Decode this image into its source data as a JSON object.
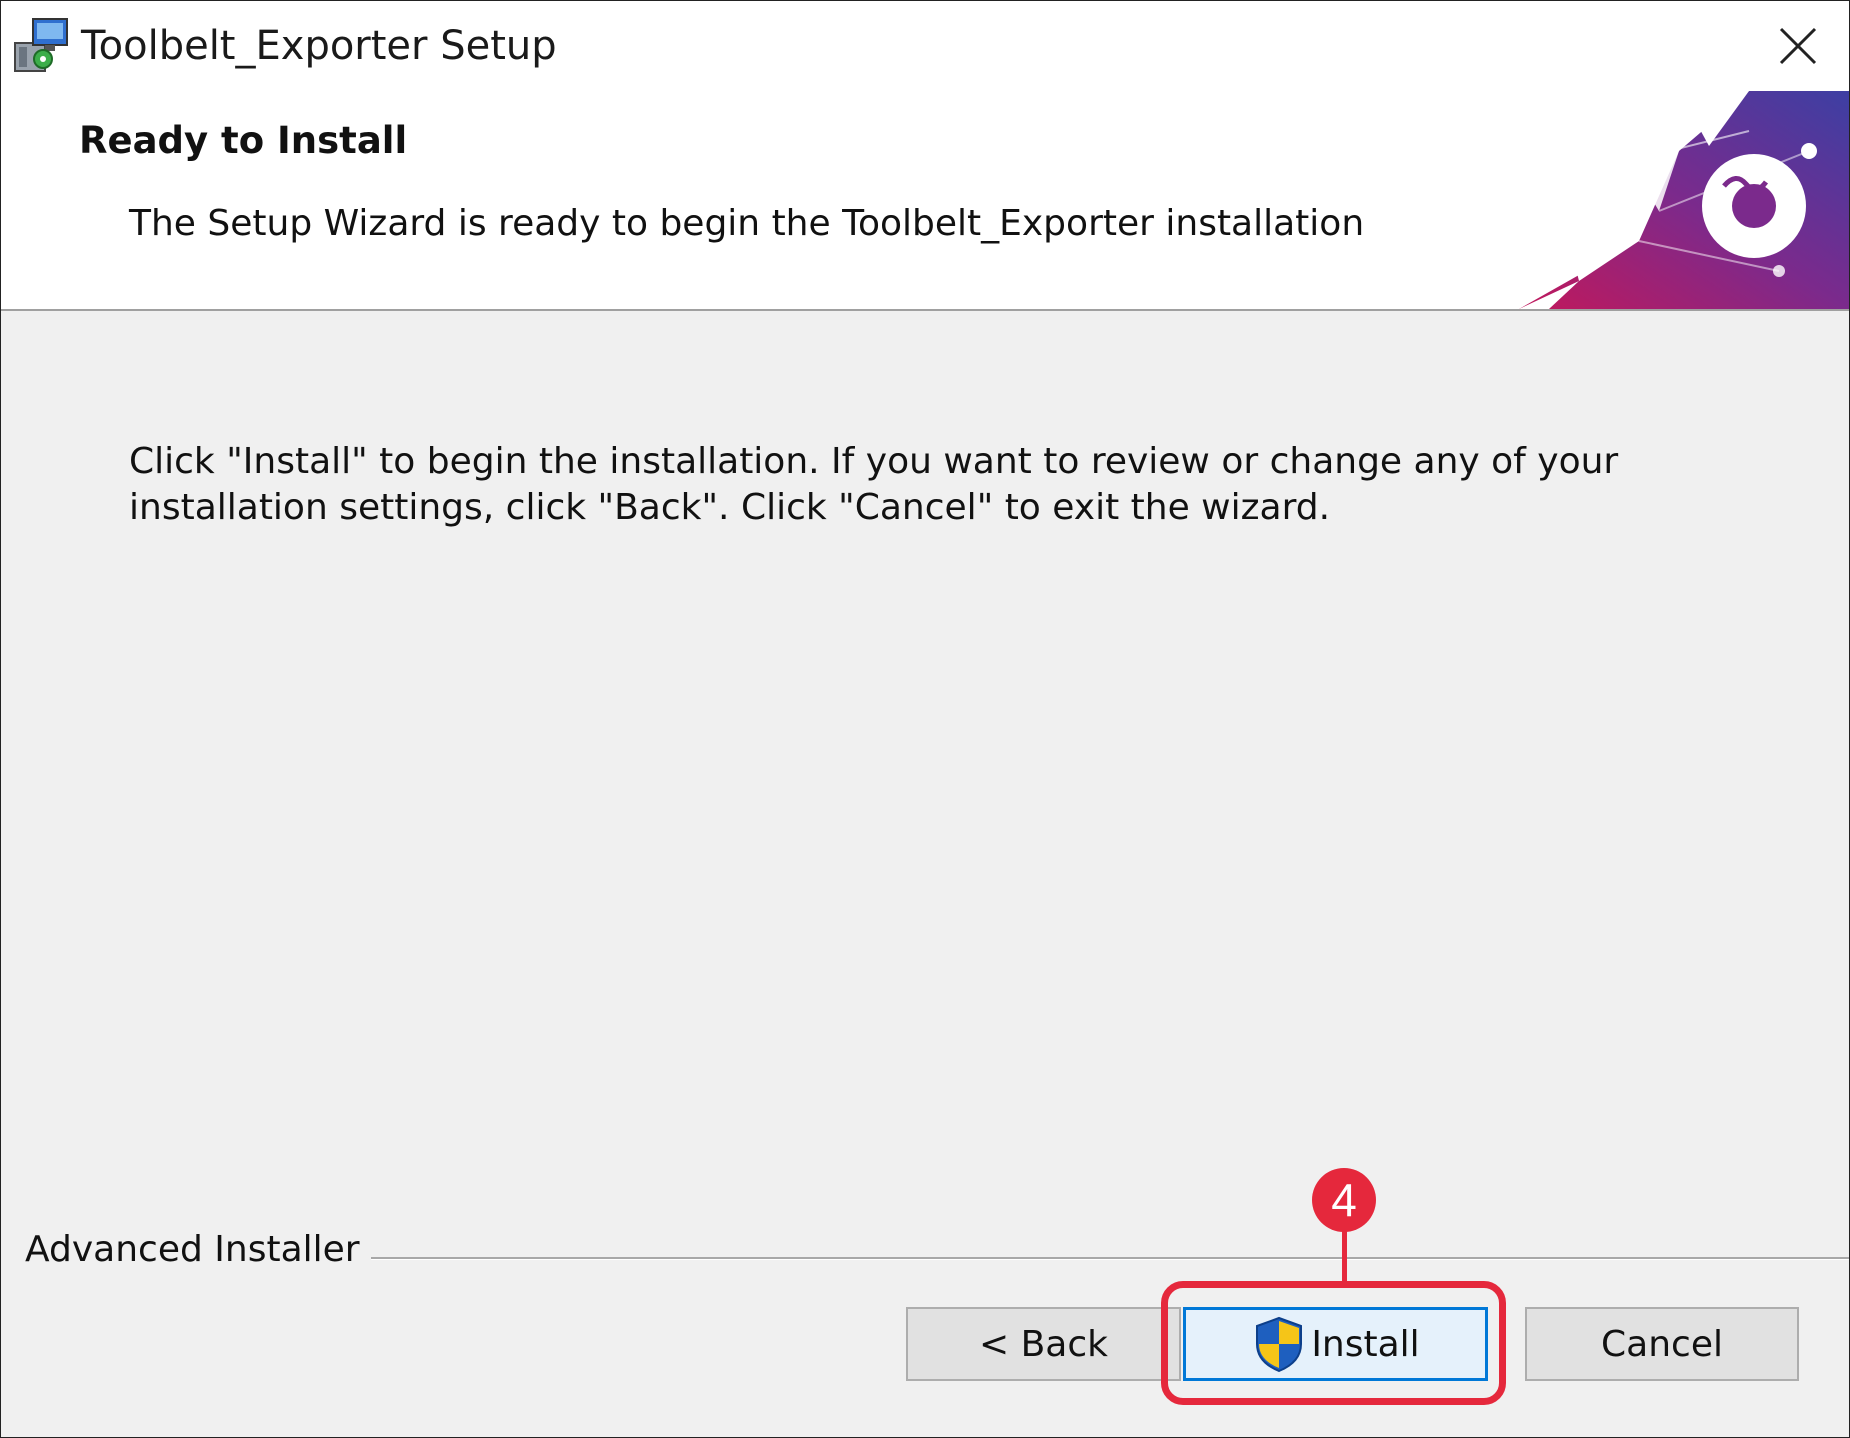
{
  "window": {
    "title": "Toolbelt_Exporter Setup",
    "close_icon": "close-icon"
  },
  "header": {
    "title": "Ready to Install",
    "subtitle": "The Setup Wizard is ready to begin the Toolbelt_Exporter installation"
  },
  "body": {
    "instructions_line1": "Click \"Install\" to begin the installation.  If you want to review or change any of your",
    "instructions_line2": "installation settings, click \"Back\".  Click \"Cancel\" to exit the wizard."
  },
  "footer": {
    "brand": "Advanced Installer",
    "back_label": "< Back",
    "install_label": "Install",
    "cancel_label": "Cancel"
  },
  "annotation": {
    "step_number": "4",
    "color": "#e5283c"
  },
  "colors": {
    "accent": "#0078d7",
    "dialog_background": "#f0f0f0",
    "banner_purple": "#5b2a86",
    "banner_magenta": "#c2185b"
  }
}
